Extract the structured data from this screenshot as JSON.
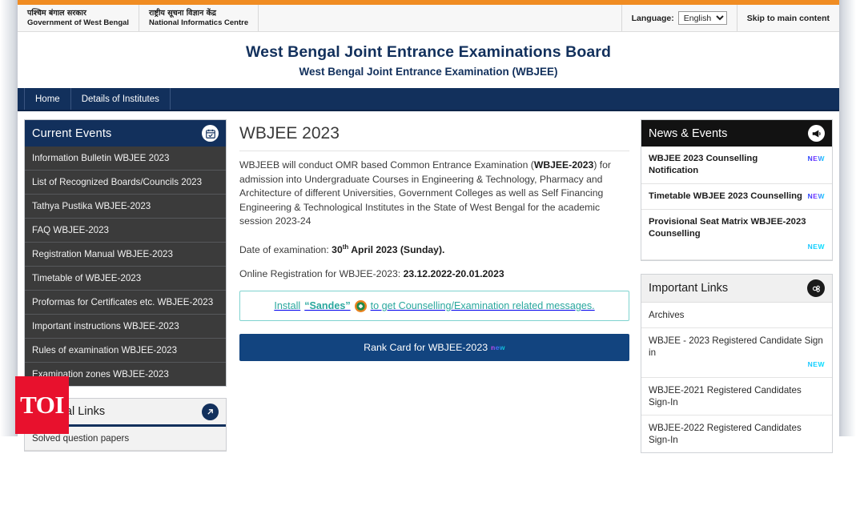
{
  "govheader": {
    "emblems": [
      {
        "hindi": "पश्चिम बंगाल सरकार",
        "english": "Government of West Bengal"
      },
      {
        "hindi": "राष्ट्रीय सूचना विज्ञान केंद्र",
        "english": "National Informatics Centre"
      }
    ],
    "language_label": "Language:",
    "language_value": "English",
    "language_options": [
      "English"
    ],
    "skip_link": "Skip to main content"
  },
  "title": {
    "main": "West Bengal Joint Entrance Examinations Board",
    "sub": "West Bengal Joint Entrance Examination (WBJEE)"
  },
  "nav": {
    "items": [
      {
        "label": "Home"
      },
      {
        "label": "Details of Institutes"
      }
    ]
  },
  "current_events": {
    "heading": "Current Events",
    "icon": "calendar-icon",
    "items": [
      {
        "label": "Information Bulletin WBJEE 2023"
      },
      {
        "label": "List of Recognized Boards/Councils 2023"
      },
      {
        "label": "Tathya Pustika WBJEE-2023"
      },
      {
        "label": "FAQ WBJEE-2023"
      },
      {
        "label": "Registration Manual WBJEE-2023"
      },
      {
        "label": "Timetable of WBJEE-2023"
      },
      {
        "label": "Proformas for Certificates etc. WBJEE-2023"
      },
      {
        "label": "Important instructions WBJEE-2023"
      },
      {
        "label": "Rules of examination WBJEE-2023"
      },
      {
        "label": "Examination zones WBJEE-2023"
      }
    ]
  },
  "external_links": {
    "heading": "External Links",
    "icon": "external-link-icon",
    "items": [
      {
        "label": "Solved question papers"
      }
    ]
  },
  "main": {
    "heading": "WBJEE 2023",
    "intro_before": "WBJEEB will conduct OMR based Common Entrance Examination (",
    "intro_bold": "WBJEE-2023",
    "intro_after": ") for admission into Undergraduate Courses in Engineering & Technology, Pharmacy and Architecture of different Universities, Government Colleges as well as Self Financing Engineering & Technological Institutes in the State of West Bengal for the academic session 2023-24",
    "exam_date_label": "Date of examination: ",
    "exam_date_day": "30",
    "exam_date_sup": "th",
    "exam_date_rest": " April 2023 (Sunday).",
    "registration_label": "Online Registration for WBJEE-2023: ",
    "registration_value": "23.12.2022-20.01.2023",
    "sandes": {
      "prefix": "Install ",
      "quoted": "“Sandes”",
      "icon": "sandes-app-icon",
      "suffix": " to get Counselling/Examination related messages."
    },
    "rank_button": {
      "label": "Rank Card for WBJEE-2023",
      "badge": "new"
    }
  },
  "news": {
    "heading": "News & Events",
    "icon": "megaphone-icon",
    "items": [
      {
        "label": "WBJEE 2023 Counselling Notification",
        "badge": "NEW",
        "badge_below": false
      },
      {
        "label": "Timetable WBJEE 2023 Counselling",
        "badge": "NEW",
        "badge_below": false
      },
      {
        "label": "Provisional Seat Matrix WBJEE-2023 Counselling",
        "badge": "NEW",
        "badge_below": true
      }
    ]
  },
  "important_links": {
    "heading": "Important Links",
    "icon": "link-chain-icon",
    "items": [
      {
        "label": "Archives",
        "badge": ""
      },
      {
        "label": "WBJEE - 2023 Registered Candidate Sign in",
        "badge": "NEW"
      },
      {
        "label": "WBJEE-2021 Registered Candidates Sign-In",
        "badge": ""
      },
      {
        "label": "WBJEE-2022 Registered Candidates Sign-In",
        "badge": ""
      }
    ]
  },
  "watermark": {
    "label": "TOI"
  }
}
